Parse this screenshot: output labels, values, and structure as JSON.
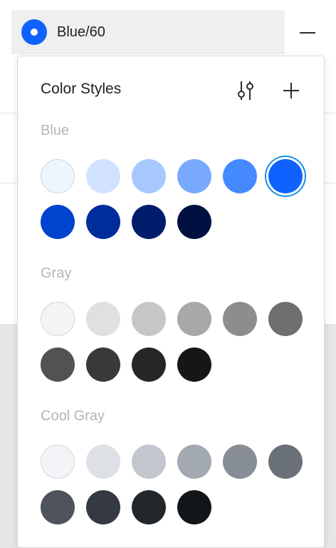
{
  "selected_style": {
    "name": "Blue/60",
    "color": "#0f62fe"
  },
  "remove_icon": "minus-icon",
  "panel": {
    "title": "Color Styles",
    "filter_icon": "sliders-icon",
    "add_icon": "plus-icon"
  },
  "sections": [
    {
      "label": "Blue",
      "swatches": [
        {
          "color": "#edf5ff",
          "light": true
        },
        {
          "color": "#d0e2ff"
        },
        {
          "color": "#a6c8ff"
        },
        {
          "color": "#78a9ff"
        },
        {
          "color": "#4589ff"
        },
        {
          "color": "#0f62fe",
          "selected": true
        },
        {
          "color": "#0043ce"
        },
        {
          "color": "#002d9c"
        },
        {
          "color": "#001d6c"
        },
        {
          "color": "#001141"
        }
      ]
    },
    {
      "label": "Gray",
      "swatches": [
        {
          "color": "#f4f4f4",
          "light": true
        },
        {
          "color": "#e0e0e0"
        },
        {
          "color": "#c6c6c6"
        },
        {
          "color": "#a8a8a8"
        },
        {
          "color": "#8d8d8d"
        },
        {
          "color": "#6f6f6f"
        },
        {
          "color": "#525252"
        },
        {
          "color": "#393939"
        },
        {
          "color": "#262626"
        },
        {
          "color": "#161616"
        }
      ]
    },
    {
      "label": "Cool Gray",
      "swatches": [
        {
          "color": "#f2f4f8",
          "light": true
        },
        {
          "color": "#dde1e6"
        },
        {
          "color": "#c1c7cd"
        },
        {
          "color": "#a2a9b0"
        },
        {
          "color": "#878d96"
        },
        {
          "color": "#697077"
        },
        {
          "color": "#4d5358"
        },
        {
          "color": "#343a3f"
        },
        {
          "color": "#21272a"
        },
        {
          "color": "#121619"
        }
      ]
    }
  ]
}
